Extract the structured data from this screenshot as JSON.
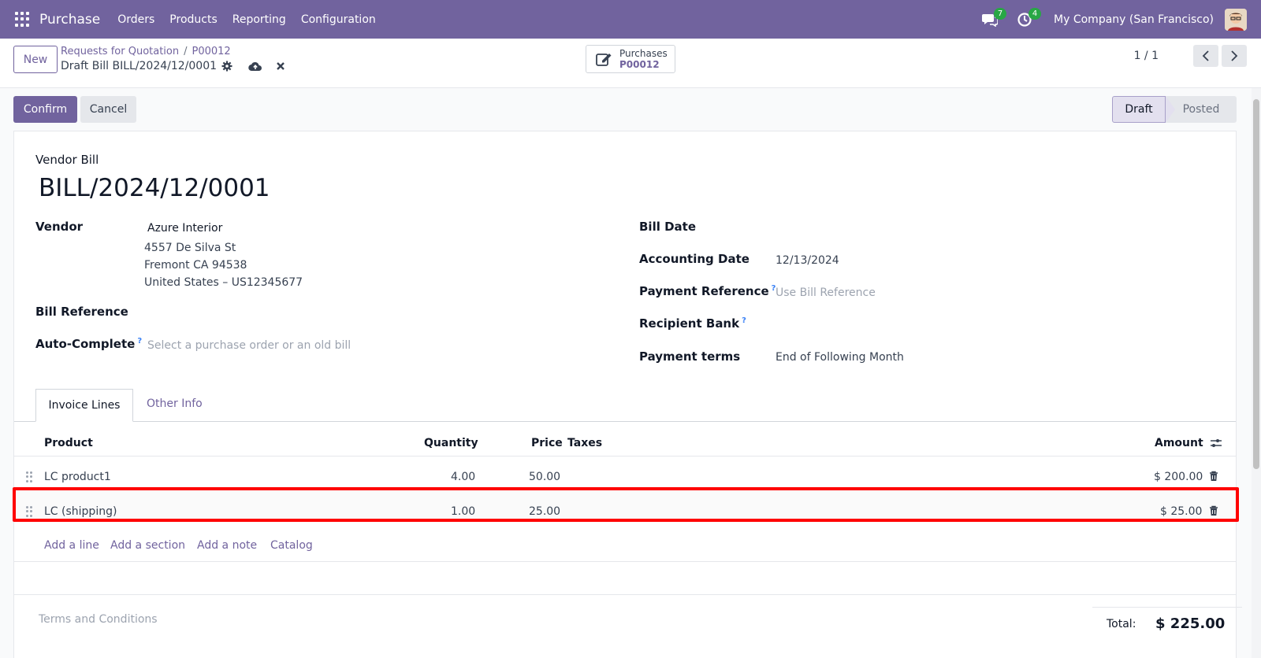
{
  "navbar": {
    "app_name": "Purchase",
    "menu": [
      "Orders",
      "Products",
      "Reporting",
      "Configuration"
    ],
    "messages_count": "7",
    "activities_count": "4",
    "company": "My Company (San Francisco)"
  },
  "control": {
    "new_label": "New",
    "breadcrumb_parent": "Requests for Quotation",
    "breadcrumb_sep": "/",
    "breadcrumb_order": "P00012",
    "record_name": "Draft Bill BILL/2024/12/0001",
    "smart_button_label": "Purchases",
    "smart_button_value": "P00012",
    "pager": "1 / 1"
  },
  "actions": {
    "confirm_label": "Confirm",
    "cancel_label": "Cancel"
  },
  "status": {
    "draft": "Draft",
    "posted": "Posted"
  },
  "form": {
    "doc_type": "Vendor Bill",
    "title": "BILL/2024/12/0001",
    "vendor_label": "Vendor",
    "vendor_name": "Azure Interior",
    "vendor_addr1": "4557 De Silva St",
    "vendor_addr2": "Fremont CA 94538",
    "vendor_addr3": "United States – US12345677",
    "bill_reference_label": "Bill Reference",
    "auto_complete_label": "Auto-Complete",
    "auto_complete_placeholder": "Select a purchase order or an old bill",
    "bill_date_label": "Bill Date",
    "accounting_date_label": "Accounting Date",
    "accounting_date": "12/13/2024",
    "payment_reference_label": "Payment Reference",
    "payment_reference_placeholder": "Use Bill Reference",
    "recipient_bank_label": "Recipient Bank",
    "payment_terms_label": "Payment terms",
    "payment_terms": "End of Following Month",
    "help_mark": "?"
  },
  "tabs": {
    "invoice_lines": "Invoice Lines",
    "other_info": "Other Info"
  },
  "table": {
    "headers": {
      "product": "Product",
      "quantity": "Quantity",
      "price": "Price",
      "taxes": "Taxes",
      "amount": "Amount"
    },
    "rows": [
      {
        "product": "LC product1",
        "quantity": "4.00",
        "price": "50.00",
        "amount": "$ 200.00"
      },
      {
        "product": "LC (shipping)",
        "quantity": "1.00",
        "price": "25.00",
        "amount": "$ 25.00"
      }
    ],
    "add_line": "Add a line",
    "add_section": "Add a section",
    "add_note": "Add a note",
    "catalog": "Catalog"
  },
  "footer": {
    "terms_placeholder": "Terms and Conditions",
    "total_label": "Total:",
    "total_value": "$ 225.00"
  },
  "colors": {
    "brand": "#71639e",
    "highlight": "#ff0000",
    "badge": "#28a745"
  }
}
